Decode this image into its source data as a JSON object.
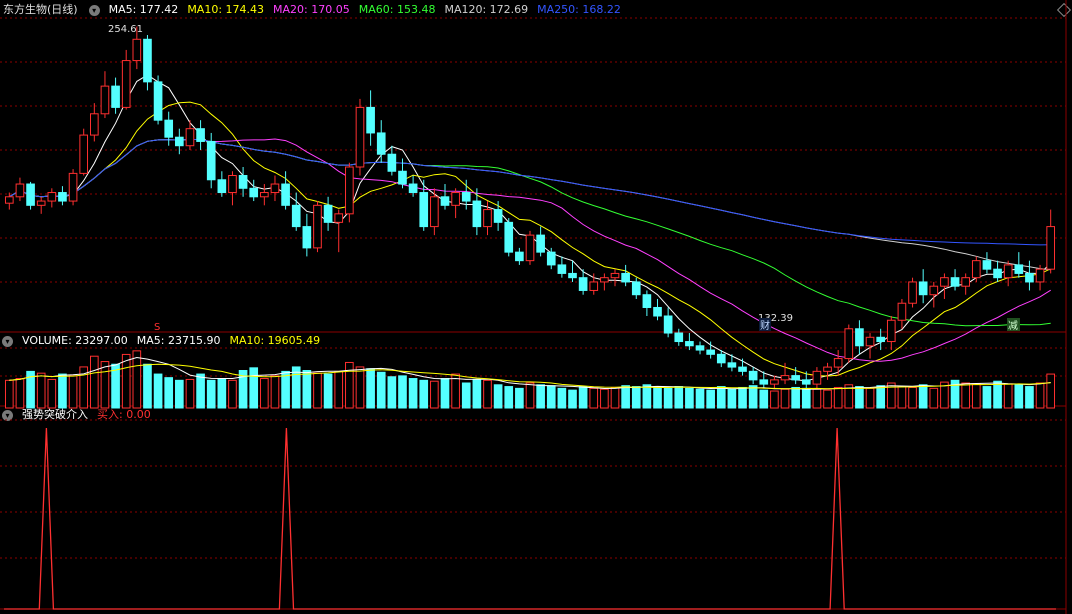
{
  "stock": {
    "title": "东方生物(日线)"
  },
  "ma_legend": [
    {
      "label": "MA5: 177.42",
      "color": "#ffffff"
    },
    {
      "label": "MA10: 174.43",
      "color": "#ffff00"
    },
    {
      "label": "MA20: 170.05",
      "color": "#ff40ff"
    },
    {
      "label": "MA60: 153.48",
      "color": "#33ff33"
    },
    {
      "label": "MA120: 172.69",
      "color": "#d0d0d0"
    },
    {
      "label": "MA250: 168.22",
      "color": "#3355ff"
    }
  ],
  "price_markers": {
    "high": "254.61",
    "low": "132.39"
  },
  "event_markers": {
    "s_mark": "S",
    "cai": "财",
    "jian": "减"
  },
  "volume": {
    "label": "VOLUME: 23297.00",
    "ma5": "MA5: 23715.90",
    "ma10": "MA10: 19605.49",
    "colors": {
      "label": "#ffffff",
      "ma5": "#ffffff",
      "ma10": "#ffff00"
    }
  },
  "indicator": {
    "name": "强势突破介入",
    "buy": "买入: 0.00",
    "colors": {
      "name": "#ffffff",
      "buy": "#ff3030"
    }
  },
  "colors": {
    "up": "#ff3030",
    "down": "#54ffff",
    "grid": "#8b0000",
    "bg": "#000000",
    "ma5": "#ffffff",
    "ma10": "#ffff00",
    "ma20": "#ff40ff",
    "ma60": "#33ff33",
    "ma120": "#d0d0d0",
    "ma250": "#3355ff",
    "signal": "#ff3030"
  },
  "chart_data": {
    "type": "candlestick",
    "candles": [
      [
        173,
        178,
        170,
        176
      ],
      [
        176,
        185,
        174,
        182
      ],
      [
        182,
        183,
        170,
        172
      ],
      [
        172,
        176,
        168,
        174
      ],
      [
        174,
        180,
        171,
        178
      ],
      [
        178,
        181,
        172,
        174
      ],
      [
        174,
        189,
        172,
        187
      ],
      [
        187,
        208,
        186,
        205
      ],
      [
        205,
        220,
        202,
        215
      ],
      [
        215,
        235,
        213,
        228
      ],
      [
        228,
        232,
        215,
        218
      ],
      [
        218,
        245,
        217,
        240
      ],
      [
        240,
        256,
        236,
        250
      ],
      [
        250,
        252,
        226,
        230
      ],
      [
        230,
        233,
        210,
        212
      ],
      [
        212,
        216,
        200,
        204
      ],
      [
        204,
        208,
        196,
        200
      ],
      [
        200,
        212,
        198,
        208
      ],
      [
        208,
        212,
        198,
        202
      ],
      [
        202,
        206,
        180,
        184
      ],
      [
        184,
        188,
        176,
        178
      ],
      [
        178,
        188,
        172,
        186
      ],
      [
        186,
        190,
        176,
        180
      ],
      [
        180,
        184,
        174,
        176
      ],
      [
        176,
        182,
        172,
        178
      ],
      [
        178,
        186,
        174,
        182
      ],
      [
        182,
        188,
        170,
        172
      ],
      [
        172,
        178,
        160,
        162
      ],
      [
        162,
        168,
        148,
        152
      ],
      [
        152,
        174,
        150,
        172
      ],
      [
        172,
        176,
        160,
        164
      ],
      [
        164,
        170,
        150,
        168
      ],
      [
        168,
        192,
        164,
        190
      ],
      [
        190,
        222,
        186,
        218
      ],
      [
        218,
        226,
        200,
        206
      ],
      [
        206,
        212,
        192,
        196
      ],
      [
        196,
        200,
        186,
        188
      ],
      [
        188,
        194,
        180,
        182
      ],
      [
        182,
        186,
        176,
        178
      ],
      [
        178,
        184,
        160,
        162
      ],
      [
        162,
        180,
        158,
        176
      ],
      [
        176,
        182,
        170,
        172
      ],
      [
        172,
        180,
        166,
        178
      ],
      [
        178,
        184,
        170,
        174
      ],
      [
        174,
        180,
        158,
        162
      ],
      [
        162,
        174,
        158,
        170
      ],
      [
        170,
        174,
        160,
        164
      ],
      [
        164,
        166,
        148,
        150
      ],
      [
        150,
        152,
        144,
        146
      ],
      [
        146,
        160,
        144,
        158
      ],
      [
        158,
        162,
        148,
        150
      ],
      [
        150,
        152,
        142,
        144
      ],
      [
        144,
        148,
        138,
        140
      ],
      [
        140,
        146,
        136,
        138
      ],
      [
        138,
        142,
        130,
        132
      ],
      [
        132,
        140,
        130,
        136
      ],
      [
        136,
        140,
        132,
        138
      ],
      [
        138,
        142,
        134,
        140
      ],
      [
        140,
        144,
        134,
        136
      ],
      [
        136,
        138,
        128,
        130
      ],
      [
        130,
        132,
        120,
        124
      ],
      [
        124,
        128,
        118,
        120
      ],
      [
        120,
        124,
        110,
        112
      ],
      [
        112,
        114,
        106,
        108
      ],
      [
        108,
        112,
        104,
        106
      ],
      [
        106,
        108,
        102,
        104
      ],
      [
        104,
        108,
        100,
        102
      ],
      [
        102,
        104,
        96,
        98
      ],
      [
        98,
        102,
        94,
        96
      ],
      [
        96,
        100,
        92,
        94
      ],
      [
        94,
        96,
        88,
        90
      ],
      [
        90,
        94,
        86,
        88
      ],
      [
        88,
        92,
        86,
        90
      ],
      [
        90,
        98,
        88,
        92
      ],
      [
        92,
        96,
        88,
        90
      ],
      [
        90,
        94,
        86,
        88
      ],
      [
        88,
        96,
        86,
        94
      ],
      [
        94,
        98,
        90,
        96
      ],
      [
        96,
        104,
        92,
        100
      ],
      [
        100,
        116,
        98,
        114
      ],
      [
        114,
        118,
        102,
        106
      ],
      [
        106,
        112,
        100,
        110
      ],
      [
        110,
        114,
        104,
        108
      ],
      [
        108,
        120,
        104,
        118
      ],
      [
        118,
        128,
        114,
        126
      ],
      [
        126,
        138,
        124,
        136
      ],
      [
        136,
        142,
        126,
        130
      ],
      [
        130,
        136,
        124,
        134
      ],
      [
        134,
        140,
        128,
        138
      ],
      [
        138,
        142,
        132,
        134
      ],
      [
        134,
        140,
        130,
        138
      ],
      [
        138,
        148,
        136,
        146
      ],
      [
        146,
        150,
        140,
        142
      ],
      [
        142,
        146,
        136,
        138
      ],
      [
        138,
        146,
        134,
        144
      ],
      [
        144,
        150,
        138,
        140
      ],
      [
        140,
        146,
        132,
        136
      ],
      [
        136,
        144,
        132,
        142
      ],
      [
        142,
        170,
        140,
        162
      ]
    ],
    "series": [
      {
        "name": "MA5",
        "values": [
          177.42
        ]
      },
      {
        "name": "MA10",
        "values": [
          174.43
        ]
      },
      {
        "name": "MA20",
        "values": [
          170.05
        ]
      },
      {
        "name": "MA60",
        "values": [
          153.48
        ]
      },
      {
        "name": "MA120",
        "values": [
          172.69
        ]
      },
      {
        "name": "MA250",
        "values": [
          168.22
        ]
      }
    ],
    "volume": [
      31,
      33,
      41,
      39,
      32,
      38,
      36,
      46,
      58,
      52,
      49,
      60,
      64,
      49,
      38,
      34,
      31,
      32,
      38,
      31,
      33,
      31,
      42,
      45,
      33,
      36,
      41,
      46,
      42,
      39,
      38,
      41,
      51,
      46,
      44,
      40,
      35,
      36,
      33,
      31,
      30,
      33,
      38,
      28,
      32,
      31,
      26,
      24,
      22,
      28,
      26,
      25,
      22,
      20,
      24,
      22,
      21,
      23,
      25,
      24,
      26,
      23,
      22,
      24,
      22,
      21,
      20,
      24,
      21,
      23,
      25,
      20,
      19,
      21,
      23,
      22,
      21,
      20,
      23,
      26,
      24,
      22,
      25,
      28,
      24,
      23,
      26,
      22,
      29,
      31,
      28,
      27,
      24,
      30,
      27,
      26,
      24,
      28,
      38
    ],
    "signal_peaks": [
      6,
      40,
      118
    ],
    "signal_count": 150,
    "ylim": [
      120,
      260
    ]
  }
}
